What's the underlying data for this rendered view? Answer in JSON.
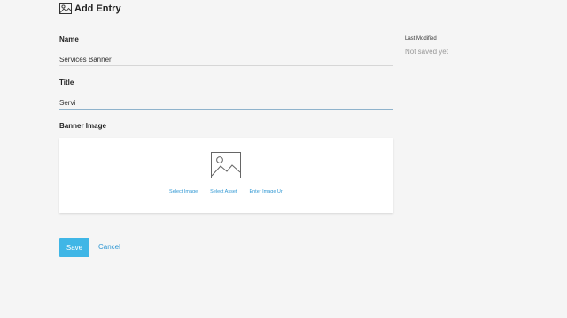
{
  "header": {
    "title": "Add Entry",
    "icon": "image-icon"
  },
  "fields": {
    "name": {
      "label": "Name",
      "value": "Services Banner"
    },
    "title": {
      "label": "Title",
      "value": "Servi"
    },
    "banner": {
      "label": "Banner Image",
      "icon": "image-placeholder-icon",
      "links": [
        "Select Image",
        "Select Asset",
        "Enter Image Url"
      ]
    }
  },
  "actions": {
    "save_label": "Save",
    "cancel_label": "Cancel"
  },
  "meta": {
    "last_modified_label": "Last Modified",
    "last_modified_value": "Not saved yet"
  },
  "colors": {
    "accent": "#3fb6e6",
    "link": "#2f97d3",
    "background": "#f5f5f5"
  }
}
